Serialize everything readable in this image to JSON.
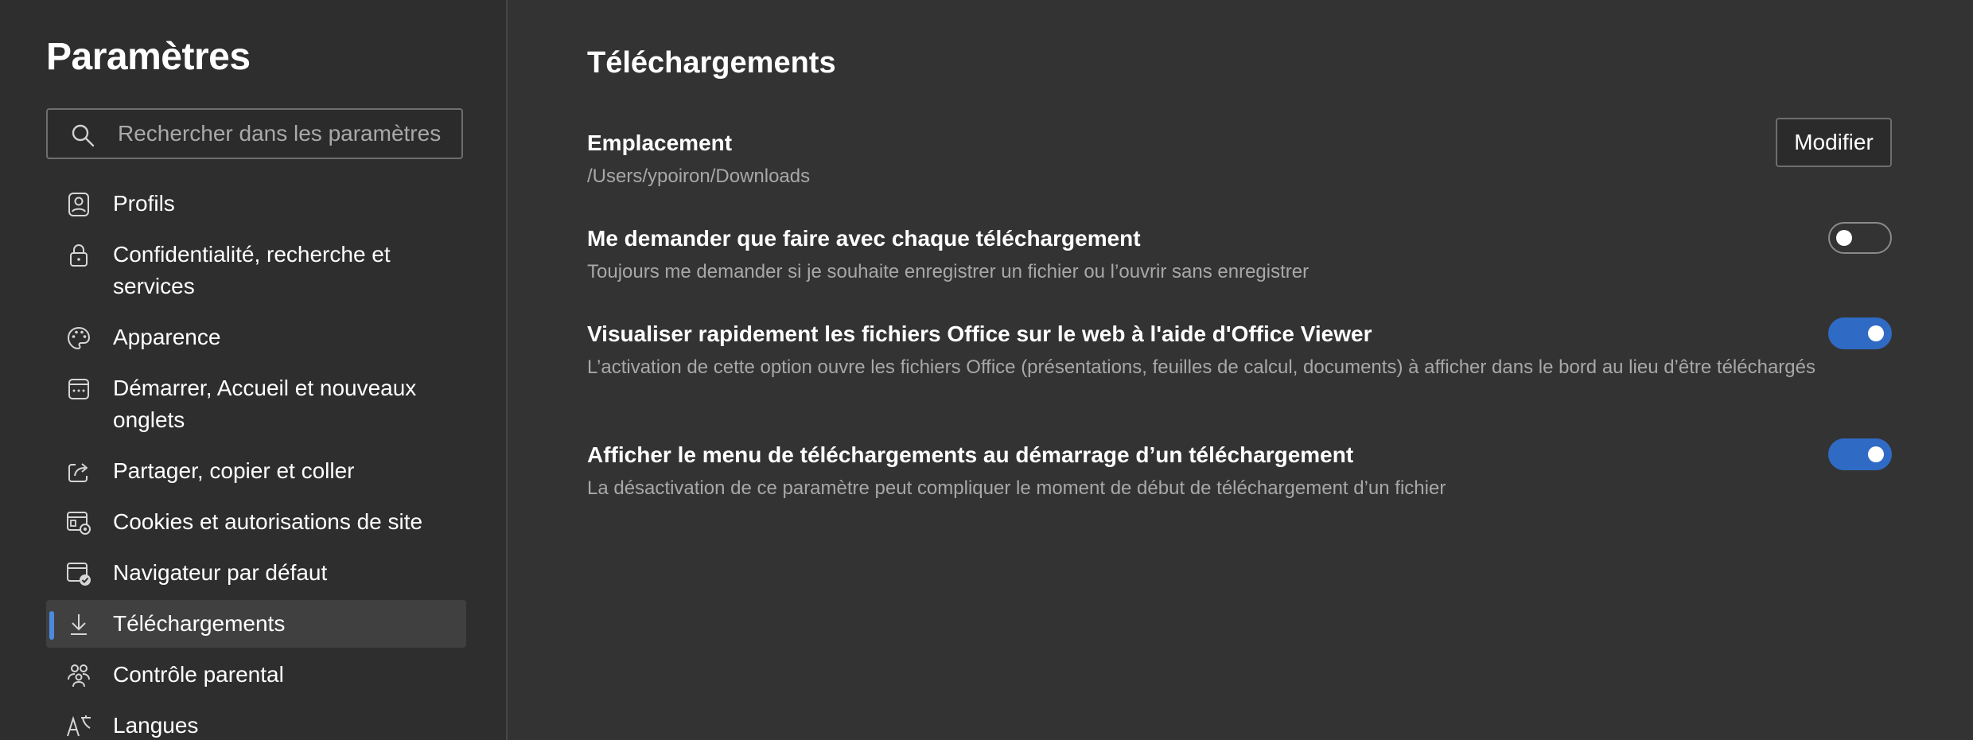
{
  "sidebar": {
    "title": "Paramètres",
    "search": {
      "placeholder": "Rechercher dans les paramètres",
      "value": ""
    },
    "items": [
      {
        "label": "Profils",
        "icon": "profile-icon",
        "active": false
      },
      {
        "label": "Confidentialité, recherche et services",
        "icon": "lock-icon",
        "active": false
      },
      {
        "label": "Apparence",
        "icon": "palette-icon",
        "active": false
      },
      {
        "label": "Démarrer, Accueil et nouveaux onglets",
        "icon": "start-page-icon",
        "active": false
      },
      {
        "label": "Partager, copier et coller",
        "icon": "share-icon",
        "active": false
      },
      {
        "label": "Cookies et autorisations de site",
        "icon": "site-permissions-icon",
        "active": false
      },
      {
        "label": "Navigateur par défaut",
        "icon": "default-browser-icon",
        "active": false
      },
      {
        "label": "Téléchargements",
        "icon": "download-icon",
        "active": true
      },
      {
        "label": "Contrôle parental",
        "icon": "family-icon",
        "active": false
      },
      {
        "label": "Langues",
        "icon": "languages-icon",
        "active": false
      }
    ]
  },
  "main": {
    "title": "Téléchargements",
    "location": {
      "title": "Emplacement",
      "path": "/Users/ypoiron/Downloads",
      "button_label": "Modifier"
    },
    "settings": [
      {
        "title": "Me demander que faire avec chaque téléchargement",
        "description": "Toujours me demander si je souhaite enregistrer un fichier ou l’ouvrir sans enregistrer",
        "enabled": false
      },
      {
        "title": "Visualiser rapidement les fichiers Office sur le web à l'aide d'Office Viewer",
        "description": "L’activation de cette option ouvre les fichiers Office (présentations, feuilles de calcul, documents) à afficher dans le bord au lieu d’être téléchargés",
        "enabled": true
      },
      {
        "title": "Afficher le menu de téléchargements au démarrage d’un téléchargement",
        "description": "La désactivation de ce paramètre peut compliquer le moment de début de téléchargement d’un fichier",
        "enabled": true
      }
    ]
  },
  "colors": {
    "background": "#333333",
    "sidebar_background": "#2e2e2e",
    "accent": "#2f6bc4",
    "active_indicator": "#4a8ae0",
    "secondary_text": "#a8a8a8"
  }
}
